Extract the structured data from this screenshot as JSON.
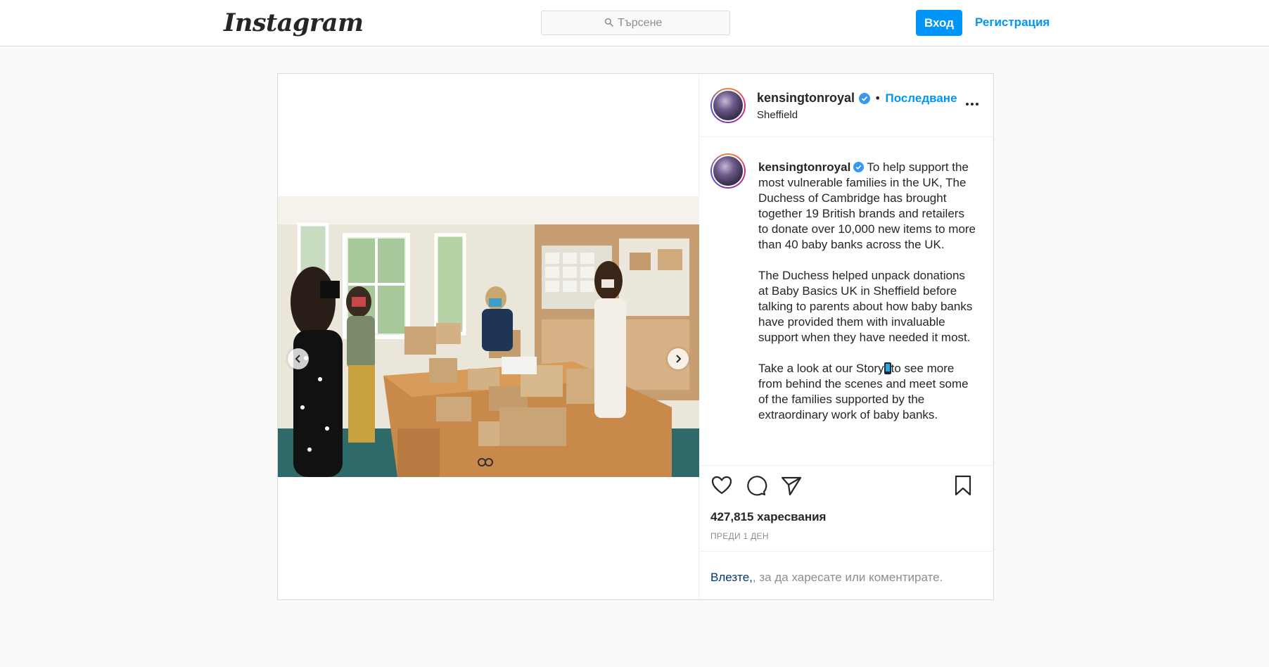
{
  "topbar": {
    "logo_text": "Instagram",
    "search_placeholder": "Търсене",
    "login_label": "Вход",
    "signup_label": "Регистрация"
  },
  "post": {
    "username": "kensingtonroyal",
    "verified": true,
    "follow_separator": "•",
    "follow_label": "Последване",
    "location": "Sheffield",
    "caption": {
      "username": "kensingtonroyal",
      "paragraph1": "To help support the most vulnerable families in the UK, The Duchess of Cambridge has brought together 19 British brands and retailers to donate over 10,000 new items to more than 40 baby banks across the UK.",
      "paragraph2": "The Duchess helped unpack donations at Baby Basics UK in Sheffield before talking to parents about how baby banks have provided them with invaluable support when they have needed it most.",
      "paragraph3_before": "Take a look at our Story",
      "paragraph3_after": "to see more from behind the scenes and meet some of the families supported by the extraordinary work of baby banks."
    },
    "likes": "427,815 харесвания",
    "timestamp": "ПРЕДИ 1 ДЕН",
    "login_prompt_link": "Влезте,",
    "login_prompt_rest": ", за да харесате или коментирате."
  },
  "icons": {
    "search": "search-icon",
    "verified": "verified-badge-icon",
    "more": "more-options-icon",
    "like": "heart-icon",
    "comment": "comment-icon",
    "share": "paper-plane-icon",
    "save": "bookmark-icon",
    "prev": "chevron-left-icon",
    "next": "chevron-right-icon",
    "story": "mobile-phone-emoji"
  },
  "colors": {
    "accent": "#0095f6",
    "verified": "#3897f0",
    "background": "#fafafa",
    "border": "#dbdbdb",
    "secondary_text": "#8e8e8e"
  }
}
